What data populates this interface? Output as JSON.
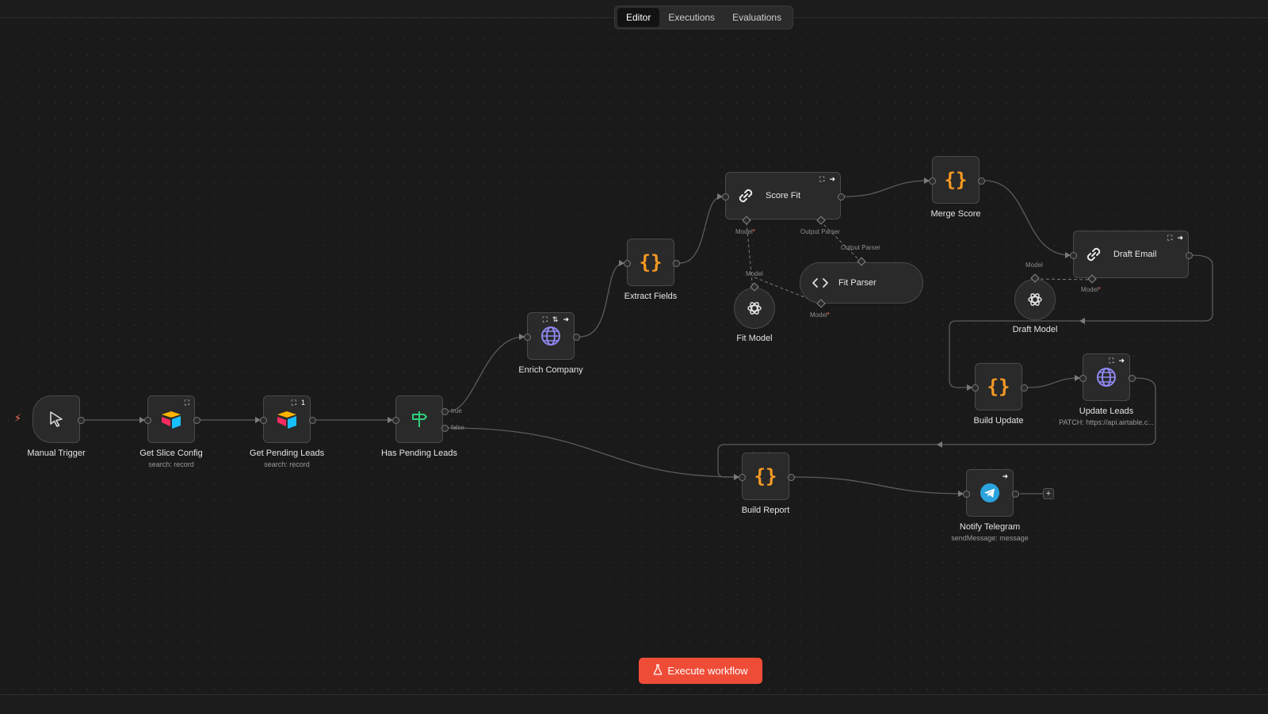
{
  "tabs": [
    {
      "label": "Editor",
      "active": true
    },
    {
      "label": "Executions",
      "active": false
    },
    {
      "label": "Evaluations",
      "active": false
    }
  ],
  "nodes": {
    "manual_trigger": {
      "label": "Manual Trigger",
      "icon": "cursor-icon"
    },
    "get_slice_config": {
      "label": "Get Slice Config",
      "sublabel": "search: record",
      "icon": "airtable-icon"
    },
    "get_pending_leads": {
      "label": "Get Pending Leads",
      "sublabel": "search: record",
      "icon": "airtable-icon",
      "badge_count": "1"
    },
    "has_pending_leads": {
      "label": "Has Pending Leads",
      "icon": "signpost-icon",
      "out_true": "true",
      "out_false": "false"
    },
    "enrich_company": {
      "label": "Enrich Company",
      "icon": "globe-icon"
    },
    "extract_fields": {
      "label": "Extract Fields",
      "icon": "braces-icon",
      "glyph": "{}"
    },
    "score_fit": {
      "label": "Score Fit",
      "icon": "chain-link-icon",
      "port_model": "Model",
      "port_output_parser": "Output Parser"
    },
    "fit_model": {
      "label": "Fit Model",
      "icon": "openai-icon",
      "port_model": "Model"
    },
    "fit_parser": {
      "label": "Fit Parser",
      "icon": "code-icon",
      "port_output_parser": "Output Parser",
      "port_model": "Model"
    },
    "merge_score": {
      "label": "Merge Score",
      "icon": "braces-icon",
      "glyph": "{}"
    },
    "draft_email": {
      "label": "Draft Email",
      "icon": "chain-link-icon",
      "port_model": "Model"
    },
    "draft_model": {
      "label": "Draft Model",
      "icon": "openai-icon",
      "port_model": "Model"
    },
    "build_update": {
      "label": "Build Update",
      "icon": "braces-icon",
      "glyph": "{}"
    },
    "update_leads": {
      "label": "Update Leads",
      "sublabel": "PATCH: https://api.airtable.c...",
      "icon": "globe-icon"
    },
    "build_report": {
      "label": "Build Report",
      "icon": "braces-icon",
      "glyph": "{}"
    },
    "notify_telegram": {
      "label": "Notify Telegram",
      "sublabel": "sendMessage: message",
      "icon": "telegram-icon"
    }
  },
  "required_marker": "*",
  "add_button": "+",
  "execute_button": {
    "label": "Execute workflow",
    "icon": "flask-icon"
  },
  "colors": {
    "accent": "#ef4c37",
    "braces": "#f59a23",
    "globe": "#8f87f1",
    "signpost": "#2fcf7b",
    "telegram": "#2aa3de"
  }
}
